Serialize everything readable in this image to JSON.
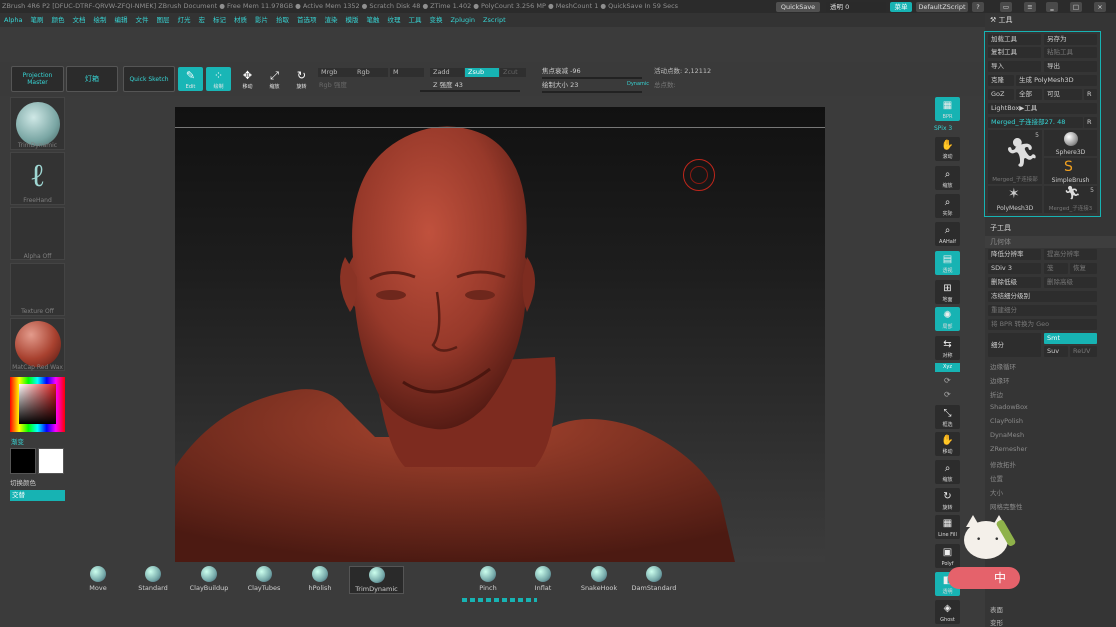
{
  "titlebar": {
    "text": "ZBrush 4R6 P2 [DFUC-DTRF-QRVW-ZFQI-NMEK]  ZBrush Document    ● Free Mem 11.978GB ● Active Mem 1352 ● Scratch Disk 48 ● ZTime 1.402 ● PolyCount 3.256 MP ● MeshCount 1 ● QuickSave In 59 Secs"
  },
  "topright": {
    "quicksave": "QuickSave",
    "transparency": "透明 0",
    "menus": "菜单",
    "script": "DefaultZScript"
  },
  "menubar": [
    "Alpha",
    "笔刷",
    "颜色",
    "文档",
    "绘制",
    "编辑",
    "文件",
    "图层",
    "灯光",
    "宏",
    "标记",
    "材质",
    "影片",
    "拾取",
    "首选项",
    "渲染",
    "模版",
    "笔触",
    "纹理",
    "工具",
    "变换",
    "Zplugin",
    "Zscript"
  ],
  "shelf": {
    "projection_master": "Projection Master",
    "lightbox": "灯箱",
    "quick_sketch": "Quick Sketch",
    "edit": "Edit",
    "draw": "绘制",
    "move": "移动",
    "scale": "缩放",
    "rotate": "旋转",
    "mrgb": "Mrgb",
    "rgb": "Rgb",
    "m": "M",
    "rgb_intensity": "Rgb 强度",
    "zadd": "Zadd",
    "zsub": "Zsub",
    "zcut": "Zcut",
    "z_intensity": "Z 强度 43",
    "focal_shift": "焦点衰减 -96",
    "draw_size": "绘制大小 23",
    "dynamic": "Dynamic",
    "active_points": "活动点数: 2,12112",
    "total_points": "总点数:"
  },
  "leftpanel": {
    "brush": "TrimDynamic",
    "stroke": "FreeHand",
    "alpha": "Alpha Off",
    "texture": "Texture Off",
    "material": "MatCap Red Wax",
    "gradient": "渐变",
    "switch_color": "切换颜色",
    "alternate": "交替"
  },
  "righttools": [
    {
      "label": "BPR",
      "icon": "bpr-icon"
    },
    {
      "label": "SPix 3",
      "icon": "spix-label"
    },
    {
      "label": "滚动",
      "icon": "scroll-icon"
    },
    {
      "label": "缩放",
      "icon": "zoom-icon"
    },
    {
      "label": "实际",
      "icon": "actual-icon"
    },
    {
      "label": "AAHalf",
      "icon": "aahalf-icon"
    },
    {
      "label": "透视",
      "icon": "persp-icon"
    },
    {
      "label": "地面",
      "icon": "floor-icon"
    },
    {
      "label": "局部",
      "icon": "local-icon"
    },
    {
      "label": "对称",
      "icon": "sym-icon"
    },
    {
      "label": "Xyz",
      "icon": "xyz-icon"
    },
    {
      "label": "框选",
      "icon": "frame-icon"
    },
    {
      "label": "移动",
      "icon": "move-icon"
    },
    {
      "label": "缩放",
      "icon": "scale-icon"
    },
    {
      "label": "旋转",
      "icon": "rotate-icon"
    },
    {
      "label": "Line Fill",
      "icon": "linefill-icon"
    },
    {
      "label": "Polyf",
      "icon": "polyf-icon"
    },
    {
      "label": "透明",
      "icon": "transp-icon"
    },
    {
      "label": "Ghost",
      "icon": "ghost-icon"
    }
  ],
  "rpanel": {
    "title": "工具",
    "load_tool": "加载工具",
    "save_as": "另存为",
    "copy_tool": "复制工具",
    "paste_tool": "粘贴工具",
    "import": "导入",
    "export": "导出",
    "clone": "克隆",
    "make_polymesh": "生成 PolyMesh3D",
    "goz": "GoZ",
    "all": "全部",
    "visible": "可见",
    "r": "R",
    "lightbox_tools": "LightBox▶工具",
    "current_tool": "Merged_子连接部27. 48",
    "thumbs": [
      {
        "label": "Merged_子连接部",
        "count": "5"
      },
      {
        "label": "Sphere3D",
        "count": ""
      },
      {
        "label": "SimpleBrush",
        "count": ""
      },
      {
        "label": "PolyMesh3D",
        "count": ""
      },
      {
        "label": "Merged_子连接3",
        "count": "5"
      }
    ],
    "subtool_head": "子工具",
    "geometry": "几何体",
    "lower_res": "降低分辨率",
    "higher_res": "提高分辨率",
    "sdiv": "SDiv 3",
    "cage": "笼",
    "rstr": "恢复",
    "del_lower": "删除低级",
    "del_higher": "删除高级",
    "freeze": "冻结细分级别",
    "reconstruct": "重建细分",
    "convert_bpr": "将 BPR 转换为 Geo",
    "divide": "细分",
    "smt": "Smt",
    "suv": "Suv",
    "reuv": "ReUV",
    "list": [
      "边缘循环",
      "边缘环",
      "折边",
      "ShadowBox",
      "ClayPolish",
      "DynaMesh",
      "ZRemesher",
      "修改拓扑",
      "位置",
      "大小",
      "网格完整性"
    ],
    "bottom": [
      "表面",
      "变形"
    ]
  },
  "brushes": [
    {
      "label": "Move"
    },
    {
      "label": "Standard"
    },
    {
      "label": "ClayBuildup"
    },
    {
      "label": "ClayTubes"
    },
    {
      "label": "hPolish"
    },
    {
      "label": "TrimDynamic"
    },
    {
      "label": "Pinch"
    },
    {
      "label": "Inflat"
    },
    {
      "label": "SnakeHook"
    },
    {
      "label": "DamStandard"
    }
  ],
  "mascot_badge": "中"
}
